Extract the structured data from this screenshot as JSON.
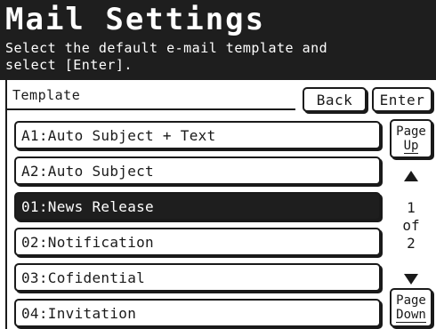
{
  "header": {
    "title": "Mail Settings",
    "instruction": "Select the default e-mail template and\nselect [Enter]."
  },
  "section": {
    "label": "Template"
  },
  "buttons": {
    "back": "Back",
    "enter": "Enter"
  },
  "templates": [
    {
      "label": "A1:Auto Subject + Text",
      "selected": false
    },
    {
      "label": "A2:Auto Subject",
      "selected": false
    },
    {
      "label": "01:News Release",
      "selected": true
    },
    {
      "label": "02:Notification",
      "selected": false
    },
    {
      "label": "03:Cofidential",
      "selected": false
    },
    {
      "label": "04:Invitation",
      "selected": false
    }
  ],
  "pagination": {
    "page_up_line1": "Page",
    "page_up_line2": "Up",
    "page_down_line1": "Page",
    "page_down_line2": "Down",
    "current": "1",
    "of": "of",
    "total": "2"
  },
  "icons": {
    "up": "triangle-up-icon",
    "down": "triangle-down-icon"
  },
  "colors": {
    "header_bg": "#1e1e1e",
    "selected_bg": "#1e1e1e",
    "foreground": "#1a1a1a",
    "background": "#ffffff"
  }
}
